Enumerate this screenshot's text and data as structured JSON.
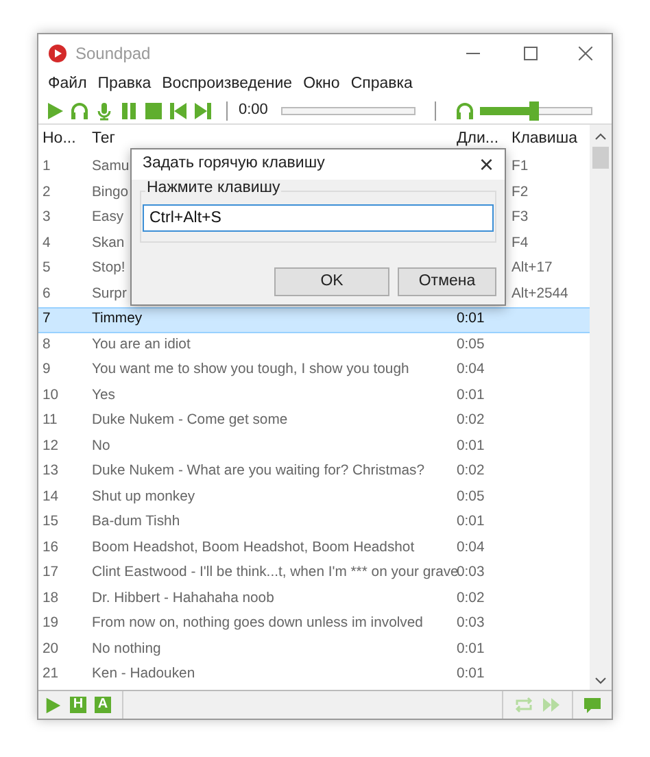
{
  "window": {
    "title": "Soundpad"
  },
  "menu": [
    "Файл",
    "Правка",
    "Воспроизведение",
    "Окно",
    "Справка"
  ],
  "toolbar": {
    "time": "0:00",
    "progress": {
      "level": 0
    },
    "volume": {
      "level": 0.47
    }
  },
  "table": {
    "columns": [
      "Но...",
      "Тег",
      "Дли...",
      "Клавиша"
    ],
    "rows": [
      {
        "number": "1",
        "tag": "Samu",
        "hotkey": "F1",
        "selected": false
      },
      {
        "number": "2",
        "tag": "Bingo",
        "hotkey": "F2",
        "selected": false
      },
      {
        "number": "3",
        "tag": "Easy",
        "hotkey": "F3",
        "selected": false
      },
      {
        "number": "4",
        "tag": "Skan",
        "hotkey": "F4",
        "selected": false
      },
      {
        "number": "5",
        "tag": "Stop!",
        "hotkey": "Alt+17",
        "selected": false
      },
      {
        "number": "6",
        "tag": "Surpr",
        "hotkey": "Alt+2544",
        "selected": false
      },
      {
        "number": "7",
        "tag": "Timmey",
        "duration": "0:01",
        "selected": true
      },
      {
        "number": "8",
        "tag": "You are an idiot",
        "duration": "0:05",
        "selected": false
      },
      {
        "number": "9",
        "tag": "You want me to show you tough, I show you tough",
        "duration": "0:04",
        "selected": false
      },
      {
        "number": "10",
        "tag": "Yes",
        "duration": "0:01",
        "selected": false
      },
      {
        "number": "11",
        "tag": "Duke Nukem - Come get some",
        "duration": "0:02",
        "selected": false
      },
      {
        "number": "12",
        "tag": "No",
        "duration": "0:01",
        "selected": false
      },
      {
        "number": "13",
        "tag": "Duke Nukem - What are you waiting for? Christmas?",
        "duration": "0:02",
        "selected": false
      },
      {
        "number": "14",
        "tag": "Shut up monkey",
        "duration": "0:05",
        "selected": false
      },
      {
        "number": "15",
        "tag": "Ba-dum Tishh",
        "duration": "0:01",
        "selected": false
      },
      {
        "number": "16",
        "tag": "Boom Headshot, Boom Headshot, Boom Headshot",
        "duration": "0:04",
        "selected": false
      },
      {
        "number": "17",
        "tag": "Clint Eastwood - I'll be think...t, when I'm *** on your grave",
        "duration": "0:03",
        "selected": false
      },
      {
        "number": "18",
        "tag": "Dr. Hibbert - Hahahaha noob",
        "duration": "0:02",
        "selected": false
      },
      {
        "number": "19",
        "tag": "From now on, nothing goes down unless im involved",
        "duration": "0:03",
        "selected": false
      },
      {
        "number": "20",
        "tag": "No nothing",
        "duration": "0:01",
        "selected": false
      },
      {
        "number": "21",
        "tag": "Ken - Hadouken",
        "duration": "0:01",
        "selected": false
      }
    ]
  },
  "status_bar": {
    "h_label": "H",
    "a_label": "A"
  },
  "dialog": {
    "title": "Задать горячую клавишу",
    "close": "×",
    "group_label": "Нажмите клавишу",
    "value": "Ctrl+Alt+S",
    "buttons": [
      "OK",
      "Отмена"
    ]
  }
}
